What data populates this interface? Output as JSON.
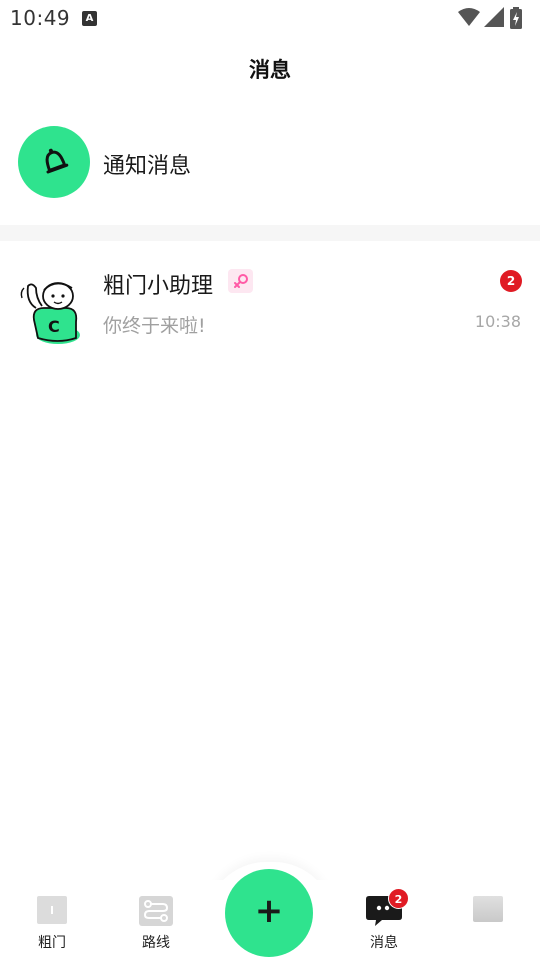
{
  "status_bar": {
    "time": "10:49",
    "a_glyph": "A",
    "icons": [
      "a-icon",
      "wifi-icon",
      "signal-icon",
      "battery-icon"
    ]
  },
  "header": {
    "title": "消息"
  },
  "notification": {
    "label": "通知消息",
    "icon": "bell-icon",
    "accent": "#2fe38e"
  },
  "chats": [
    {
      "name": "粗门小助理",
      "tag_icon": "female-icon",
      "preview": "你终于来啦!",
      "time": "10:38",
      "badge": "2"
    }
  ],
  "bottom_nav": {
    "items": [
      {
        "label": "粗门",
        "icon": "home-icon"
      },
      {
        "label": "路线",
        "icon": "route-icon"
      },
      {
        "label": "消息",
        "icon": "message-icon",
        "badge": "2"
      },
      {
        "label": "",
        "icon": "profile-icon"
      }
    ],
    "fab_symbol": "+",
    "fab_color": "#2fe38e"
  },
  "colors": {
    "accent": "#2fe38e",
    "badge": "#e01b24"
  }
}
